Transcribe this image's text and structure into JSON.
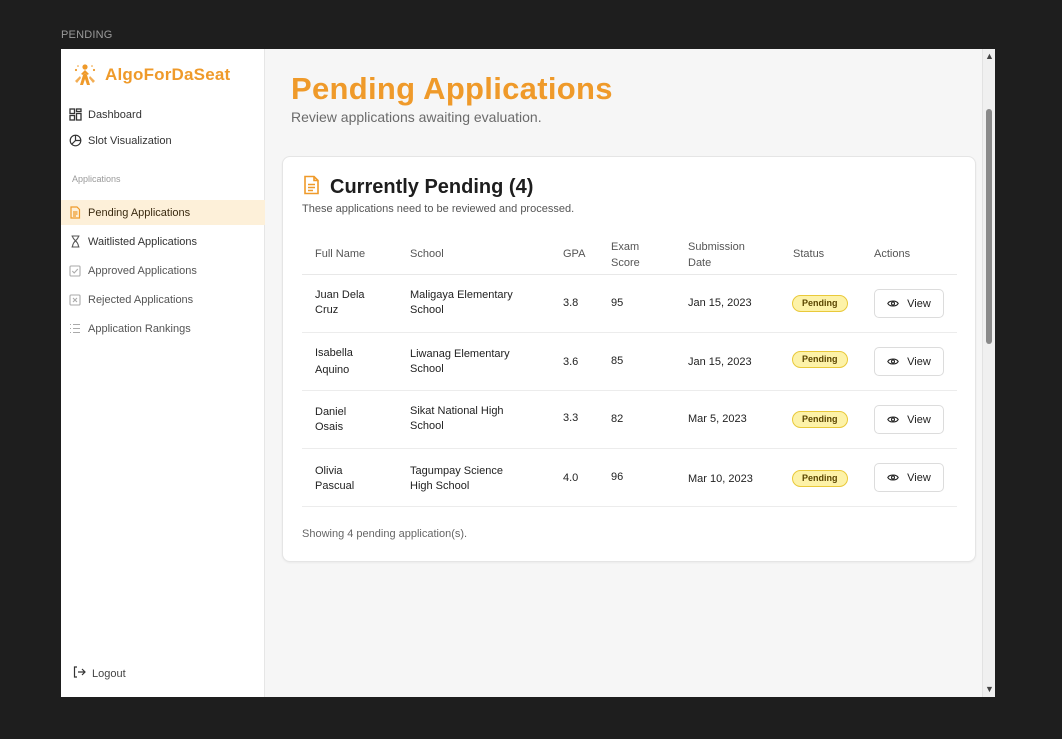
{
  "frame": {
    "label": "PENDING"
  },
  "sidebar": {
    "brand": "AlgoForDaSeat",
    "top_items": [
      {
        "label": "Dashboard",
        "icon": "dashboard-icon"
      },
      {
        "label": "Slot Visualization",
        "icon": "pie-chart-icon"
      }
    ],
    "section_label": "Applications",
    "app_items": [
      {
        "label": "Pending Applications",
        "icon": "document-icon",
        "active": true
      },
      {
        "label": "Waitlisted Applications",
        "icon": "hourglass-icon"
      },
      {
        "label": "Approved Applications",
        "icon": "check-square-icon"
      },
      {
        "label": "Rejected Applications",
        "icon": "x-square-icon"
      },
      {
        "label": "Application Rankings",
        "icon": "list-icon"
      }
    ],
    "logout_label": "Logout"
  },
  "main": {
    "title": "Pending Applications",
    "subtitle": "Review applications awaiting evaluation."
  },
  "card": {
    "title": "Currently Pending (4)",
    "description": "These applications need to be reviewed and processed.",
    "columns": {
      "name": "Full Name",
      "school": "School",
      "gpa": "GPA",
      "exam_1": "Exam",
      "exam_2": "Score",
      "date_1": "Submission",
      "date_2": "Date",
      "status": "Status",
      "actions": "Actions"
    },
    "rows": [
      {
        "name_1": "Juan Dela",
        "name_2": "Cruz",
        "school_1": "Maligaya Elementary",
        "school_2": "School",
        "gpa": "3.8",
        "exam": "95",
        "date": "Jan 15, 2023",
        "status": "Pending",
        "action": "View"
      },
      {
        "name_1": "Isabella",
        "name_2": "Aquino",
        "school_1": "Liwanag Elementary",
        "school_2": "School",
        "gpa": "3.6",
        "exam": "85",
        "date": "Jan 15, 2023",
        "status": "Pending",
        "action": "View"
      },
      {
        "name_1": "Daniel",
        "name_2": "Osais",
        "school_1": "Sikat National High",
        "school_2": "School",
        "gpa": "3.3",
        "exam": "82",
        "date": "Mar 5, 2023",
        "status": "Pending",
        "action": "View"
      },
      {
        "name_1": "Olivia",
        "name_2": "Pascual",
        "school_1": "Tagumpay Science",
        "school_2": "High School",
        "gpa": "4.0",
        "exam": "96",
        "date": "Mar 10, 2023",
        "status": "Pending",
        "action": "View"
      }
    ],
    "footer": "Showing 4 pending application(s)."
  },
  "colors": {
    "accent": "#ef9a2a",
    "active_bg": "#fdf0d9",
    "badge_bg": "#fdf2a8",
    "badge_border": "#e9c93a"
  }
}
